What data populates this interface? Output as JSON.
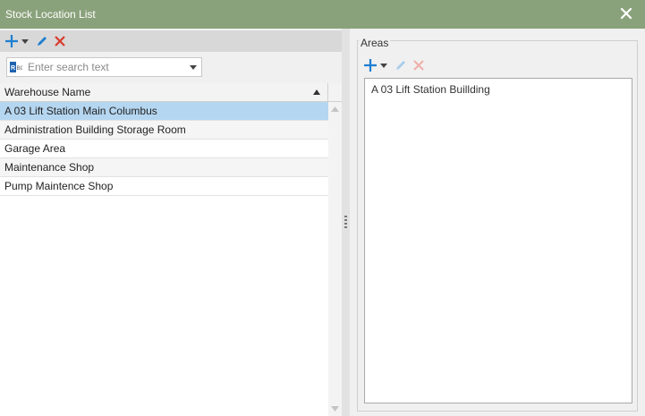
{
  "window": {
    "title": "Stock Location List"
  },
  "icons": {
    "close": "close-icon",
    "add": "plus-icon",
    "add_menu": "chevron-down-icon",
    "edit": "pencil-icon",
    "delete": "x-icon",
    "search_mode": "abc-icon",
    "dropdown": "chevron-down-icon",
    "sort": "sort-ascending-icon"
  },
  "colors": {
    "titlebar": "#8aa27b",
    "accent_blue": "#1e7fd0",
    "delete_red": "#d93a2b",
    "selection": "#b5d6f0"
  },
  "search": {
    "placeholder": "Enter search text",
    "value": ""
  },
  "grid": {
    "columns": [
      "Warehouse Name"
    ],
    "sort_direction": "ascending",
    "rows": [
      "A 03 Lift Station Main Columbus",
      "Administration Building Storage Room",
      "Garage Area",
      "Maintenance Shop",
      "Pump Maintence Shop"
    ],
    "selected_index": 0
  },
  "areas": {
    "title": "Areas",
    "items": [
      "A 03 Lift Station Buillding"
    ]
  }
}
